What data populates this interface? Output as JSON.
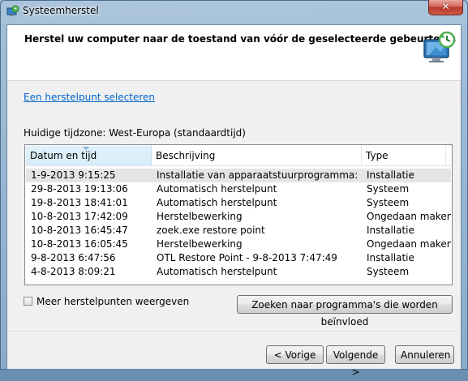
{
  "window": {
    "title": "Systeemherstel",
    "close_label": "✕"
  },
  "header": {
    "title": "Herstel uw computer naar de toestand van vóór de geselecteerde gebeurtenis",
    "icon": "system-restore-icon"
  },
  "link": {
    "label": "Een herstelpunt selecteren"
  },
  "timezone": {
    "text": "Huidige tijdzone: West-Europa (standaardtijd)"
  },
  "table": {
    "columns": [
      "Datum en tijd",
      "Beschrijving",
      "Type"
    ],
    "sorted_column": "Datum en tijd",
    "rows": [
      [
        "1-9-2013 9:15:25",
        "Installatie van apparaatstuurprogramma: Parallel...",
        "Installatie"
      ],
      [
        "29-8-2013 19:13:06",
        "Automatisch herstelpunt",
        "Systeem"
      ],
      [
        "19-8-2013 18:41:01",
        "Automatisch herstelpunt",
        "Systeem"
      ],
      [
        "10-8-2013 17:42:09",
        "Herstelbewerking",
        "Ongedaan maken"
      ],
      [
        "10-8-2013 16:45:47",
        "zoek.exe restore point",
        "Installatie"
      ],
      [
        "10-8-2013 16:05:45",
        "Herstelbewerking",
        "Ongedaan maken"
      ],
      [
        "9-8-2013 6:47:56",
        "OTL Restore Point - 9-8-2013 7:47:49",
        "Installatie"
      ],
      [
        "4-8-2013 8:09:21",
        "Automatisch herstelpunt",
        "Systeem"
      ]
    ],
    "selected_row": 0
  },
  "checkbox": {
    "label": "Meer herstelpunten weergeven",
    "checked": false
  },
  "buttons": {
    "search": "Zoeken naar programma's die worden beïnvloed",
    "back": "< Vorige",
    "next": "Volgende >",
    "cancel": "Annuleren"
  }
}
